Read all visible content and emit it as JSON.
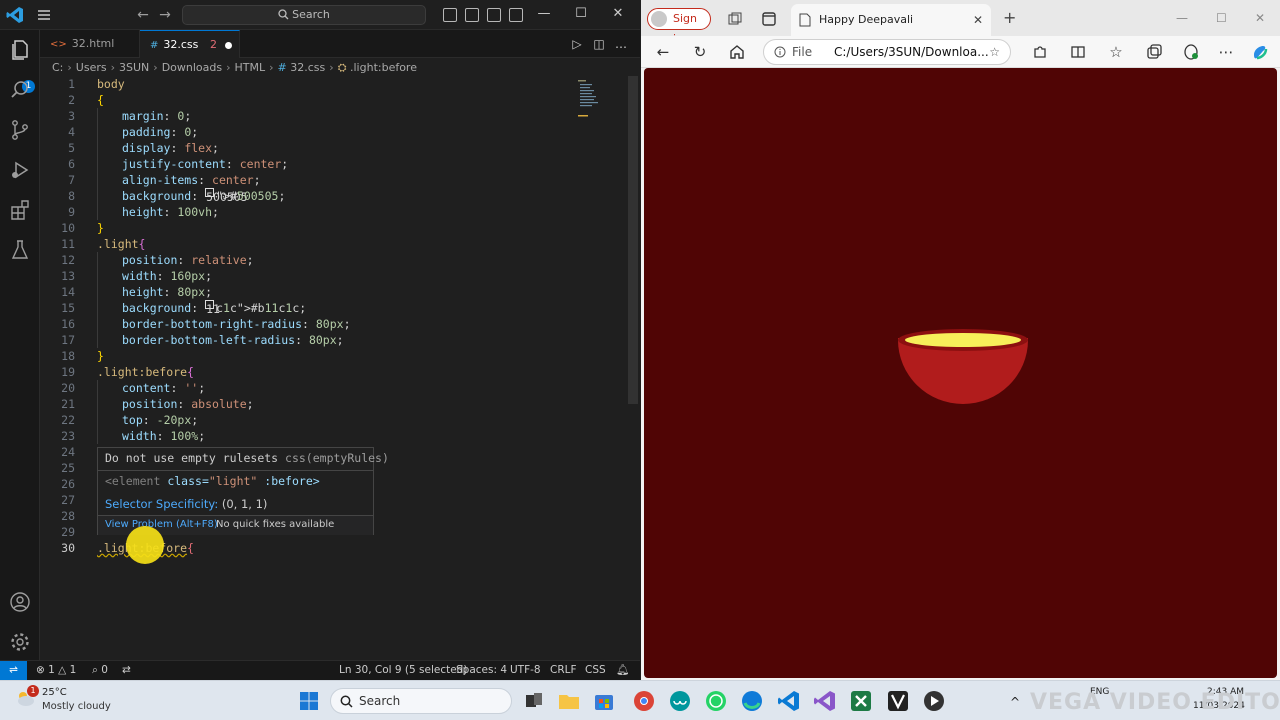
{
  "vscode": {
    "search_placeholder": "Search",
    "tabs": [
      {
        "icon": "<>",
        "label": "32.html"
      },
      {
        "icon": "#",
        "label": "32.css",
        "problems": "2"
      }
    ],
    "breadcrumb": [
      "C:",
      "Users",
      "3SUN",
      "Downloads",
      "HTML",
      "32.css",
      ".light:before"
    ],
    "activity_badge": "1",
    "code": [
      {
        "n": "1",
        "t": "body"
      },
      {
        "n": "2",
        "t": "{"
      },
      {
        "n": "3",
        "t": "margin: 0;"
      },
      {
        "n": "4",
        "t": "padding: 0;"
      },
      {
        "n": "5",
        "t": "display: flex;"
      },
      {
        "n": "6",
        "t": "justify-content: center;"
      },
      {
        "n": "7",
        "t": "align-items: center;"
      },
      {
        "n": "8",
        "t": "background: #500505;"
      },
      {
        "n": "9",
        "t": "height: 100vh;"
      },
      {
        "n": "10",
        "t": "}"
      },
      {
        "n": "11",
        "t": ".light{"
      },
      {
        "n": "12",
        "t": "position: relative;"
      },
      {
        "n": "13",
        "t": "width: 160px;"
      },
      {
        "n": "14",
        "t": "height: 80px;"
      },
      {
        "n": "15",
        "t": "background: #b11c1c;"
      },
      {
        "n": "16",
        "t": "border-bottom-right-radius: 80px;"
      },
      {
        "n": "17",
        "t": "border-bottom-left-radius: 80px;"
      },
      {
        "n": "18",
        "t": "}"
      },
      {
        "n": "19",
        "t": ".light:before{"
      },
      {
        "n": "20",
        "t": "content: '';"
      },
      {
        "n": "21",
        "t": "position: absolute;"
      },
      {
        "n": "22",
        "t": "top:-20px;"
      },
      {
        "n": "23",
        "t": "width:100%;"
      },
      {
        "n": "24",
        "t": ""
      },
      {
        "n": "25",
        "t": ""
      },
      {
        "n": "26",
        "t": ""
      },
      {
        "n": "27",
        "t": ""
      },
      {
        "n": "28",
        "t": ""
      },
      {
        "n": "29",
        "t": ""
      },
      {
        "n": "30",
        "t": ".light:before{"
      }
    ],
    "hover": {
      "message": "Do not use empty rulesets",
      "rule": "css(emptyRules)",
      "element_tag": "<element",
      "element_attr": "class=",
      "element_val": "\"light\"",
      "element_pseudo": ":before>",
      "specificity_label": "Selector Specificity:",
      "specificity_value": "(0, 1, 1)",
      "view_problem": "View Problem (Alt+F8)",
      "no_fixes": "No quick fixes available"
    },
    "status": {
      "errors": "1",
      "warnings": "1",
      "ports": "0",
      "cursor": "Ln 30, Col 9 (5 selected)",
      "spaces": "Spaces: 4",
      "encoding": "UTF-8",
      "eol": "CRLF",
      "language": "CSS"
    }
  },
  "edge": {
    "sign_in": "Sign in",
    "tab_title": "Happy Deepavali",
    "address_prefix": "File",
    "address": "C:/Users/3SUN/Downloa...",
    "page_background": "#500505",
    "bowl_color": "#b11c1c",
    "flame_color": "#f7ef5a"
  },
  "taskbar": {
    "temperature": "25°C",
    "condition": "Mostly cloudy",
    "weather_badge": "1",
    "search": "Search",
    "lang": "ENG",
    "time": "2:43 AM",
    "date": "11/03/2024",
    "watermark": "VEGA VIDEO EDITOR"
  }
}
